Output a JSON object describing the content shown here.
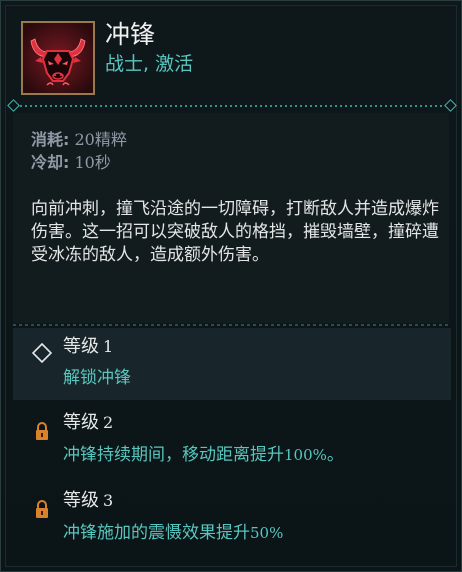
{
  "skill": {
    "name": "冲锋",
    "tags": "战士, 激活",
    "icon": "charging-bull-icon"
  },
  "stats": {
    "cost_label": "消耗:",
    "cost_value": "20精粹",
    "cooldown_label": "冷却:",
    "cooldown_value": "10秒"
  },
  "description": "向前冲刺，撞飞沿途的一切障碍，打断敌人并造成爆炸伤害。这一招可以突破敌人的格挡，摧毁墙壁，撞碎遭受冰冻的敌人，造成额外伤害。",
  "levels": [
    {
      "label": "等级",
      "number": "1",
      "text": "解锁冲锋",
      "icon": "diamond-outline-icon",
      "state": "unlocked"
    },
    {
      "label": "等级",
      "number": "2",
      "text_prefix": "冲锋持续期间，移动距离提升",
      "text_num": "100%",
      "text_suffix": "。",
      "icon": "lock-icon",
      "state": "locked"
    },
    {
      "label": "等级",
      "number": "3",
      "text_prefix": "冲锋施加的震慑效果提升",
      "text_num": "50%",
      "text_suffix": "",
      "icon": "lock-icon",
      "state": "locked"
    }
  ],
  "colors": {
    "accent_teal": "#58c6bf",
    "lock_orange": "#d9822b",
    "icon_red": "#e0313f",
    "background": "#0d1619"
  }
}
